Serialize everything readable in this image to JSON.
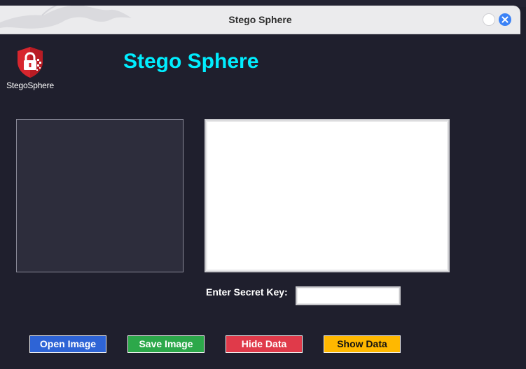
{
  "window": {
    "title": "Stego Sphere",
    "controls": {
      "minimize_icon": "circle-icon",
      "close_icon": "close-icon"
    }
  },
  "logo": {
    "icon": "shield-lock-icon",
    "text": "StegoSphere"
  },
  "app": {
    "heading": "Stego Sphere"
  },
  "secret_key": {
    "label": "Enter Secret Key:",
    "value": ""
  },
  "data_text": {
    "value": ""
  },
  "buttons": {
    "open_image": "Open Image",
    "save_image": "Save Image",
    "hide_data": "Hide Data",
    "show_data": "Show Data"
  },
  "colors": {
    "background": "#1f1f2d",
    "heading": "#00eeff",
    "open_image": "#2e64d6",
    "save_image": "#2ca84a",
    "hide_data": "#e03a4a",
    "show_data": "#ffb800",
    "close_button": "#3b82f6"
  }
}
